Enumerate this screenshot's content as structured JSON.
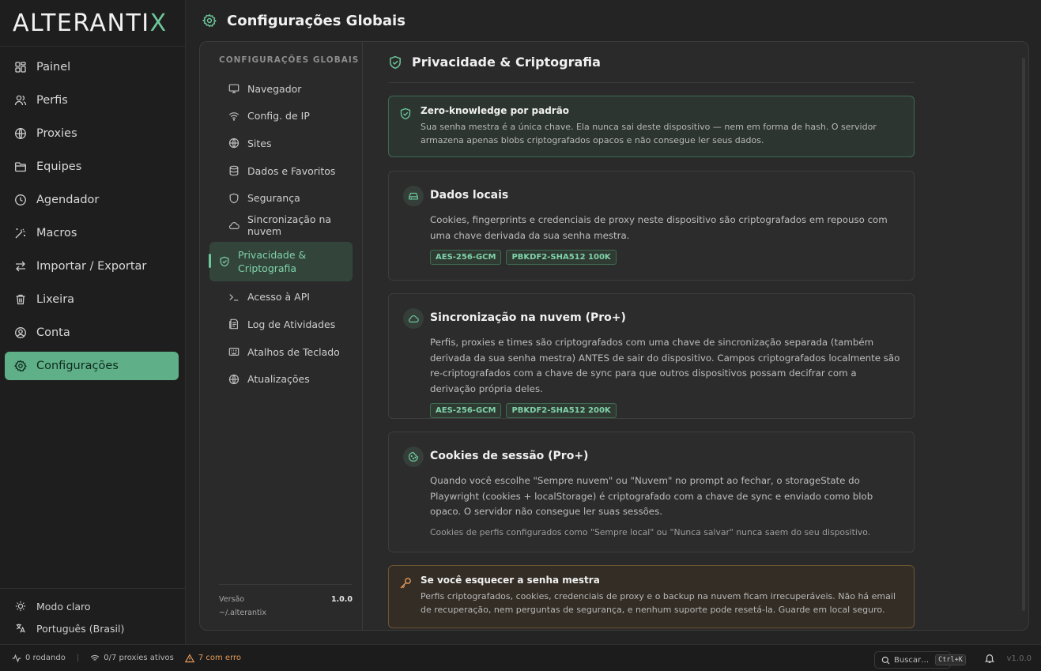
{
  "app": {
    "logo_main": "ALTERANTI",
    "logo_x": "X"
  },
  "sidebar": {
    "items": [
      {
        "label": "Painel",
        "icon": "dashboard-icon"
      },
      {
        "label": "Perfis",
        "icon": "users-icon"
      },
      {
        "label": "Proxies",
        "icon": "globe-icon"
      },
      {
        "label": "Equipes",
        "icon": "folder-icon"
      },
      {
        "label": "Agendador",
        "icon": "clock-icon"
      },
      {
        "label": "Macros",
        "icon": "magic-wand-icon"
      },
      {
        "label": "Importar / Exportar",
        "icon": "arrows-icon"
      },
      {
        "label": "Lixeira",
        "icon": "trash-icon"
      },
      {
        "label": "Conta",
        "icon": "user-circle-icon"
      },
      {
        "label": "Configurações",
        "icon": "gear-icon",
        "active": true
      }
    ],
    "theme_label": "Modo claro",
    "language_label": "Português (Brasil)"
  },
  "header": {
    "title": "Configurações Globais"
  },
  "subnav": {
    "heading": "CONFIGURAÇÕES GLOBAIS",
    "items": [
      {
        "label": "Navegador",
        "icon": "monitor-icon"
      },
      {
        "label": "Config. de IP",
        "icon": "wifi-icon"
      },
      {
        "label": "Sites",
        "icon": "globe-icon"
      },
      {
        "label": "Dados e Favoritos",
        "icon": "database-icon"
      },
      {
        "label": "Segurança",
        "icon": "shield-icon"
      },
      {
        "label": "Sincronização na nuvem",
        "icon": "cloud-icon"
      },
      {
        "label": "Privacidade & Criptografia",
        "icon": "shield-check-icon",
        "active": true
      },
      {
        "label": "Acesso à API",
        "icon": "terminal-icon"
      },
      {
        "label": "Log de Atividades",
        "icon": "log-icon"
      },
      {
        "label": "Atalhos de Teclado",
        "icon": "keyboard-icon"
      },
      {
        "label": "Atualizações",
        "icon": "globe-icon"
      }
    ],
    "version_label": "Versão",
    "version_path": "~/.alterantix",
    "version_value": "1.0.0"
  },
  "content": {
    "title": "Privacidade & Criptografia",
    "zero_knowledge": {
      "title": "Zero-knowledge por padrão",
      "description": "Sua senha mestra é a única chave. Ela nunca sai deste dispositivo — nem em forma de hash. O servidor armazena apenas blobs criptografados opacos e não consegue ler seus dados."
    },
    "cards": [
      {
        "title": "Dados locais",
        "icon": "drive-icon",
        "description": "Cookies, fingerprints e credenciais de proxy neste dispositivo são criptografados em repouso com uma chave derivada da sua senha mestra.",
        "badges": [
          "AES-256-GCM",
          "PBKDF2-SHA512 100K"
        ]
      },
      {
        "title": "Sincronização na nuvem (Pro+)",
        "icon": "cloud-icon",
        "description": "Perfis, proxies e times são criptografados com uma chave de sincronização separada (também derivada da sua senha mestra) ANTES de sair do dispositivo. Campos criptografados localmente são re-criptografados com a chave de sync para que outros dispositivos possam decifrar com a derivação própria deles.",
        "badges": [
          "AES-256-GCM",
          "PBKDF2-SHA512 200K"
        ]
      },
      {
        "title": "Cookies de sessão (Pro+)",
        "icon": "cookie-icon",
        "description": "Quando você escolhe \"Sempre nuvem\" ou \"Nuvem\" no prompt ao fechar, o storageState do Playwright (cookies + localStorage) é criptografado com a chave de sync e enviado como blob opaco. O servidor não consegue ler suas sessões.",
        "note": "Cookies de perfis configurados como \"Sempre local\" ou \"Nunca salvar\" nunca saem do seu dispositivo."
      }
    ],
    "warning": {
      "title": "Se você esquecer a senha mestra",
      "description": "Perfis criptografados, cookies, credenciais de proxy e o backup na nuvem ficam irrecuperáveis. Não há email de recuperação, nem perguntas de segurança, e nenhum suporte pode resetá-la. Guarde em local seguro."
    }
  },
  "statusbar": {
    "running": "0 rodando",
    "proxies": "0/7 proxies ativos",
    "errors": "7 com erro",
    "search_placeholder": "Buscar…",
    "shortcut": "Ctrl+K",
    "version": "v1.0.0"
  },
  "colors": {
    "accent": "#6cc79a",
    "active_nav": "#5fb088",
    "warning": "#e39a5a",
    "background": "#242424"
  }
}
